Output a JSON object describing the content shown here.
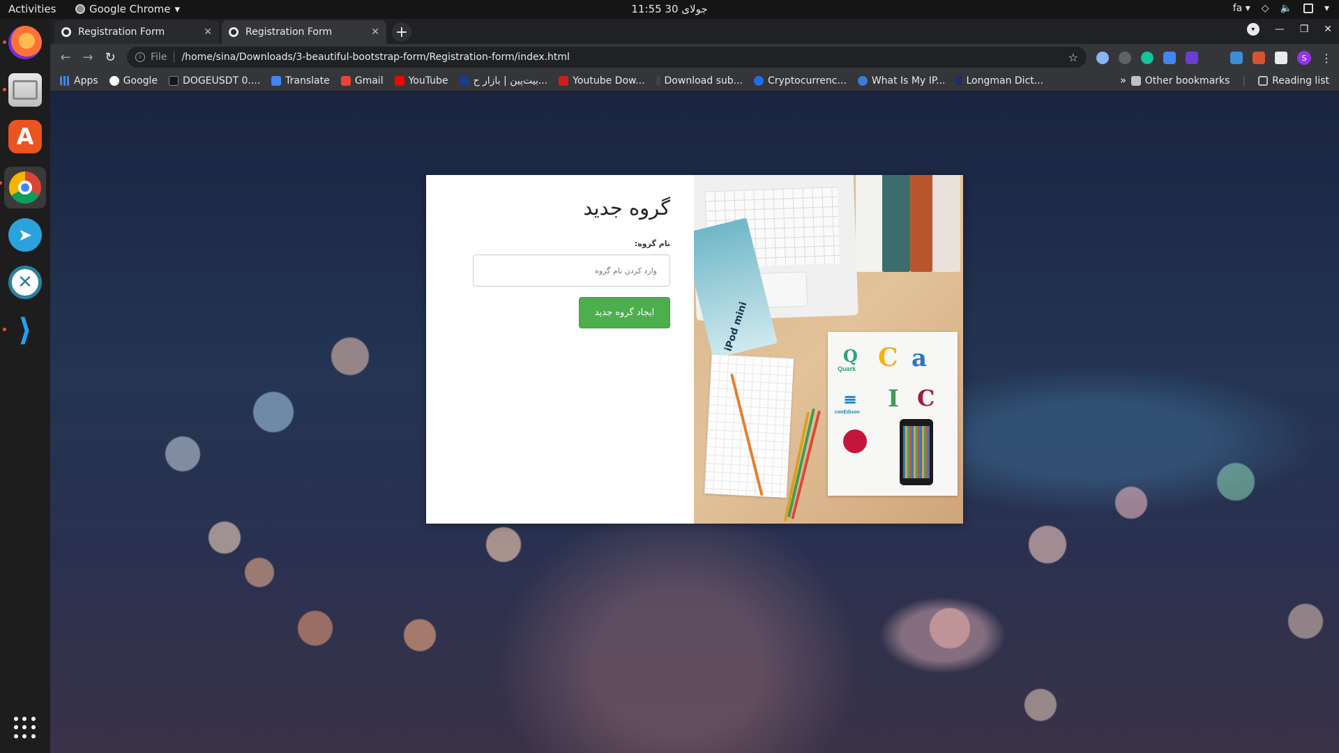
{
  "os": {
    "activities": "Activities",
    "app_menu": "Google Chrome",
    "clock": "جولای 30  11:55",
    "input_lang": "fa"
  },
  "browser": {
    "tabs": [
      {
        "title": "Registration Form",
        "active": false
      },
      {
        "title": "Registration Form",
        "active": true
      }
    ],
    "omnibox": {
      "scheme": "File",
      "url": "/home/sina/Downloads/3-beautiful-bootstrap-form/Registration-form/index.html"
    },
    "profile_initial": "S",
    "bookmarks": [
      {
        "label": "Apps",
        "color": "#4285f4"
      },
      {
        "label": "Google",
        "color": "#ffffff"
      },
      {
        "label": "DOGEUSDT 0....",
        "color": "#131722"
      },
      {
        "label": "Translate",
        "color": "#4285f4"
      },
      {
        "label": "Gmail",
        "color": "#ea4335"
      },
      {
        "label": "YouTube",
        "color": "#ff0000"
      },
      {
        "label": "بیت‌پین | بازار ح...",
        "color": "#1e3a8a"
      },
      {
        "label": "Youtube Dow...",
        "color": "#d01c1c"
      },
      {
        "label": "Download sub...",
        "color": "#444444"
      },
      {
        "label": "Cryptocurrenc...",
        "color": "#1f6feb"
      },
      {
        "label": "What Is My IP...",
        "color": "#3a7bd5"
      },
      {
        "label": "Longman Dict...",
        "color": "#1c2c6c"
      }
    ],
    "bookmarks_more": "»",
    "other_bookmarks": "Other bookmarks",
    "reading_list": "Reading list"
  },
  "page": {
    "form": {
      "title": "گروه جدید",
      "label": "نام گروه:",
      "input_placeholder": "وارد کردن نام گروه",
      "input_value": "",
      "submit": "ایجاد گروه جدید"
    },
    "illustration": {
      "ipad_text": "iPod mini",
      "logos": [
        "Quark",
        "conEdison"
      ]
    }
  },
  "colors": {
    "button": "#4cae4c",
    "chrome_dark": "#202124",
    "chrome_toolbar": "#35363a",
    "dock": "#1d1d1d",
    "ubuntu_accent": "#e95420"
  }
}
